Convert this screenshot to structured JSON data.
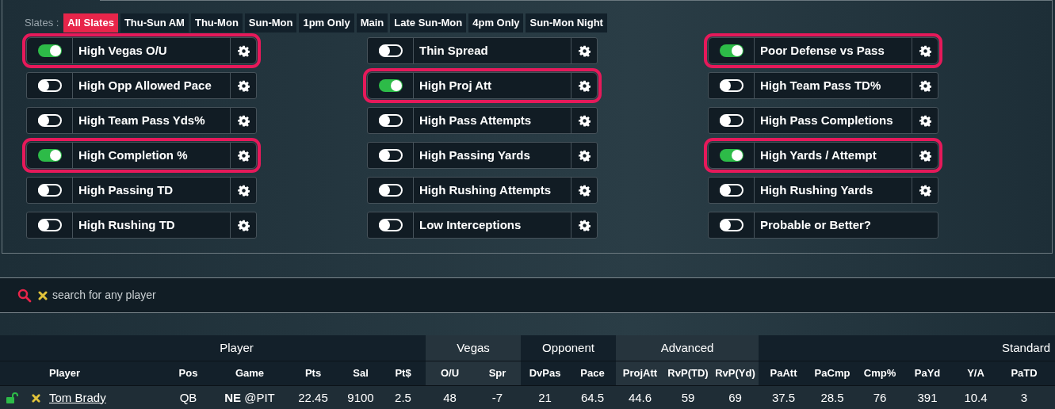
{
  "slates": {
    "label": "Slates :",
    "items": [
      {
        "label": "All Slates",
        "selected": true
      },
      {
        "label": "Thu-Sun AM",
        "selected": false
      },
      {
        "label": "Thu-Mon",
        "selected": false
      },
      {
        "label": "Sun-Mon",
        "selected": false
      },
      {
        "label": "1pm Only",
        "selected": false
      },
      {
        "label": "Main",
        "selected": false
      },
      {
        "label": "Late Sun-Mon",
        "selected": false
      },
      {
        "label": "4pm Only",
        "selected": false
      },
      {
        "label": "Sun-Mon Night",
        "selected": false
      }
    ]
  },
  "filters": [
    {
      "label": "High Vegas O/U",
      "on": true,
      "settings": true
    },
    {
      "label": "Thin Spread",
      "on": false,
      "settings": true
    },
    {
      "label": "Poor Defense vs Pass",
      "on": true,
      "settings": true
    },
    {
      "label": "High Opp Allowed Pace",
      "on": false,
      "settings": true
    },
    {
      "label": "High Proj Att",
      "on": true,
      "settings": true
    },
    {
      "label": "High Team Pass TD%",
      "on": false,
      "settings": true
    },
    {
      "label": "High Team Pass Yds%",
      "on": false,
      "settings": true
    },
    {
      "label": "High Pass Attempts",
      "on": false,
      "settings": true
    },
    {
      "label": "High Pass Completions",
      "on": false,
      "settings": true
    },
    {
      "label": "High Completion %",
      "on": true,
      "settings": true
    },
    {
      "label": "High Passing Yards",
      "on": false,
      "settings": true
    },
    {
      "label": "High Yards / Attempt",
      "on": true,
      "settings": true
    },
    {
      "label": "High Passing TD",
      "on": false,
      "settings": true
    },
    {
      "label": "High Rushing Attempts",
      "on": false,
      "settings": true
    },
    {
      "label": "High Rushing Yards",
      "on": false,
      "settings": true
    },
    {
      "label": "High Rushing TD",
      "on": false,
      "settings": true
    },
    {
      "label": "Low Interceptions",
      "on": false,
      "settings": true
    },
    {
      "label": "Probable or Better?",
      "on": false,
      "settings": false
    }
  ],
  "search": {
    "placeholder": "search for any player"
  },
  "table": {
    "groups": [
      {
        "label": "Player",
        "columns": [
          "Player",
          "Pos",
          "Game",
          "Pts",
          "Sal",
          "Pt$"
        ]
      },
      {
        "label": "Vegas",
        "columns": [
          "O/U",
          "Spr"
        ]
      },
      {
        "label": "Opponent",
        "columns": [
          "DvPas",
          "Pace"
        ]
      },
      {
        "label": "Advanced",
        "columns": [
          "ProjAtt",
          "RvP(TD)",
          "RvP(Yd)"
        ]
      },
      {
        "label": "Standard",
        "columns": [
          "PaAtt",
          "PaCmp",
          "Cmp%",
          "PaYd",
          "Y/A",
          "PaTD"
        ]
      }
    ],
    "rows": [
      {
        "locked": false,
        "player": "Tom Brady",
        "values": [
          "QB",
          "**NE** @PIT",
          "22.45",
          "9100",
          "2.5",
          "48",
          "-7",
          "21",
          "64.5",
          "44.6",
          "59",
          "69",
          "37.5",
          "28.5",
          "76",
          "391",
          "10.4",
          "3"
        ]
      }
    ]
  }
}
